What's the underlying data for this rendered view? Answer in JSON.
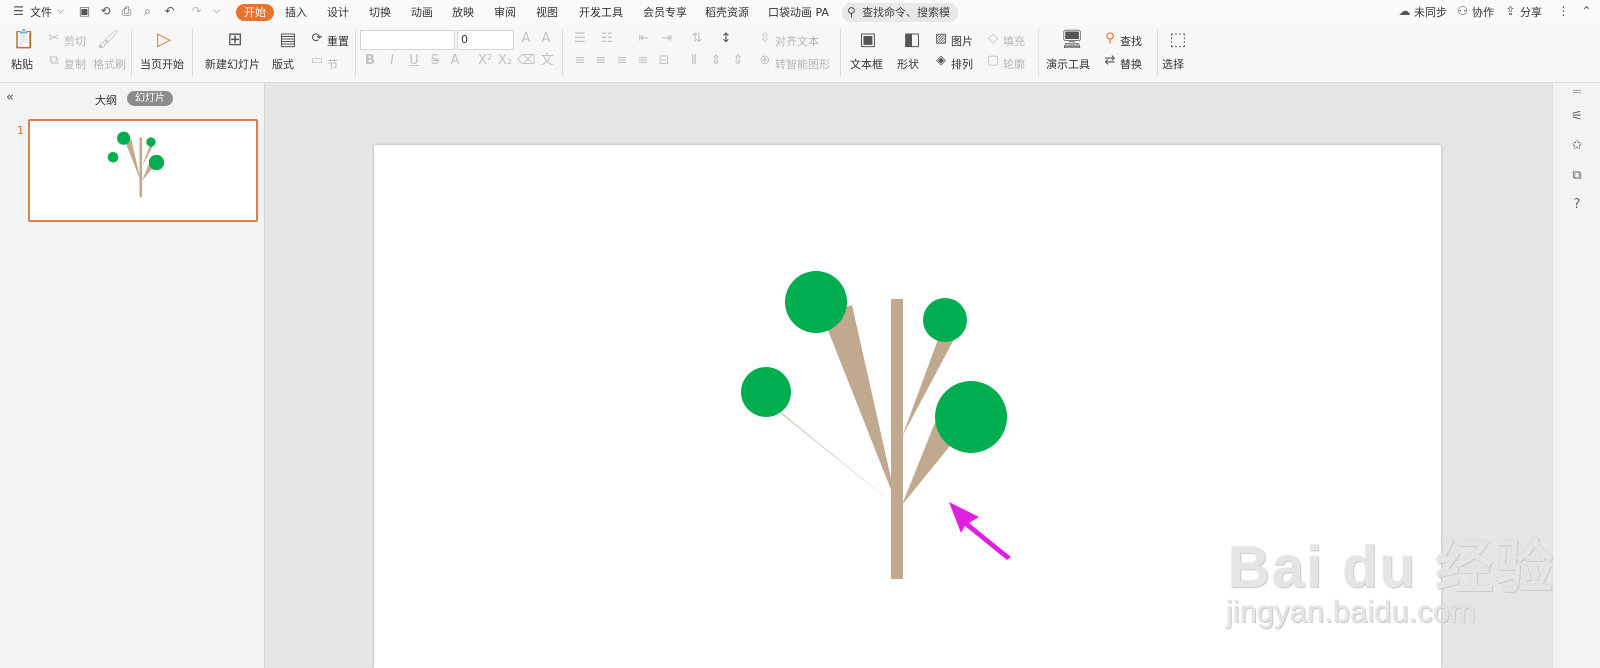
{
  "menubar": {
    "file": "文件",
    "tabs": [
      "开始",
      "插入",
      "设计",
      "切换",
      "动画",
      "放映",
      "审阅",
      "视图",
      "开发工具",
      "会员专享",
      "稻壳资源",
      "口袋动画 PA"
    ],
    "search_placeholder": "查找命令、搜索模板",
    "right": {
      "sync": "未同步",
      "collab": "协作",
      "share": "分享"
    }
  },
  "ribbon": {
    "paste": "粘贴",
    "cut": "剪切",
    "copy": "复制",
    "format_painter": "格式刷",
    "from_current": "当页开始",
    "new_slide": "新建幻灯片",
    "layout": "版式",
    "reset": "重置",
    "section": "节",
    "font_size_value": "0",
    "align_text": "对齐文本",
    "smartart": "转智能图形",
    "textbox": "文本框",
    "shape": "形状",
    "picture": "图片",
    "arrange": "排列",
    "fill": "填充",
    "outline": "轮廓",
    "present_tools": "演示工具",
    "find": "查找",
    "replace": "替换",
    "select": "选择"
  },
  "panel": {
    "collapse_icon": "double-chevron-left-icon",
    "outline_tab": "大纲",
    "slides_tab": "幻灯片",
    "slide_number": "1"
  },
  "colors": {
    "accent": "#e8712b",
    "leaf": "#00ad4f",
    "trunk": "#c1a98f",
    "arrow": "#e020e0"
  },
  "watermark": {
    "brand": "Bai du 经验",
    "url": "jingyan.baidu.com"
  }
}
